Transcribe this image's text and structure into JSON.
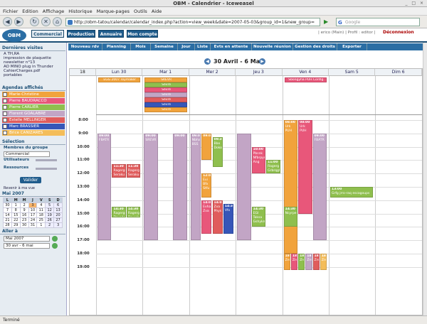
{
  "window": {
    "title": "OBM - Calendrier - Iceweasel",
    "controls": "_ □ ×"
  },
  "menu": [
    "Fichier",
    "Edition",
    "Affichage",
    "Historique",
    "Marque-pages",
    "Outils",
    "Aide"
  ],
  "nav": {
    "url": "http://obm-tatou/calendar/calendar_index.php?action=view_week&date=2007-05-03&group_id=1&new_group=",
    "search_placeholder": "Google",
    "search_engine_glyph": "G",
    "go_glyph": "▶",
    "back_glyph": "◀",
    "forward_glyph": "▶",
    "reload_glyph": "↻",
    "stop_glyph": "✕",
    "home_glyph": "⌂"
  },
  "app": {
    "logo": "OBM",
    "tabs": [
      "Commercial",
      "Production",
      "Annuaire",
      "Mon compte"
    ],
    "user_info": "| erico (Main) | Profil : editor |",
    "logout": "Déconnexion"
  },
  "sidebar": {
    "recent_title": "Dernières visites",
    "recent": [
      "A TH,RA",
      "impression de plaquette",
      "newsletter n°13",
      "AO MINO plug in Thunder",
      "CahierCharges.pdf",
      "portables"
    ],
    "agendas_title": "Agendas affichés",
    "agendas": [
      {
        "name": "Marie-Christine",
        "color": "#f1a33c"
      },
      {
        "name": "Pierre BAUDRACCO",
        "color": "#e8577a"
      },
      {
        "name": "Pierre CARLIER",
        "color": "#8fbf4e"
      },
      {
        "name": "Florent GOALABRE",
        "color": "#c2a5c5"
      },
      {
        "name": "Estelle MELLINGER",
        "color": "#e05c5c"
      },
      {
        "name": "Marc BRASSIER",
        "color": "#3656b8"
      },
      {
        "name": "Brice CANIZARES",
        "color": "#f4bd5a"
      }
    ],
    "selection_title": "Sélection",
    "group_label": "Membres du groupe",
    "group_value": "Commercial",
    "users_label": "Utilisateurs",
    "resources_label": "Ressources",
    "validate": "Valider",
    "back_to_view": "Revenir à ma vue",
    "month_title": "Mai 2007",
    "weekdays": [
      "L",
      "M",
      "M",
      "J",
      "V",
      "S",
      "D"
    ],
    "weeks": [
      [
        "30",
        "1",
        "2",
        "3",
        "4",
        "5",
        "6"
      ],
      [
        "7",
        "8",
        "9",
        "10",
        "11",
        "12",
        "13"
      ],
      [
        "14",
        "15",
        "16",
        "17",
        "18",
        "19",
        "20"
      ],
      [
        "21",
        "22",
        "23",
        "24",
        "25",
        "26",
        "27"
      ],
      [
        "28",
        "29",
        "30",
        "31",
        "1",
        "2",
        "3"
      ]
    ],
    "today": "3",
    "goto_title": "Aller à",
    "goto_month": "Mai 2007",
    "goto_week": "30 avr - 6 mai"
  },
  "toolbar": [
    "Nouveau rdv",
    "Planning",
    "Mois",
    "Semaine",
    "Jour",
    "Liste",
    "Evts en attente",
    "Nouvelle réunion",
    "Gestion des droits",
    "Exporter"
  ],
  "calendar": {
    "range": "30 Avril - 6 Mai",
    "week": "18",
    "days": [
      "Lun 30",
      "Mar 1",
      "Mer 2",
      "Jeu 3",
      "Ven 4",
      "Sam 5",
      "Dim 6"
    ],
    "hours": [
      "8:00",
      "9:00",
      "10:00",
      "11:00",
      "12:00",
      "13:00",
      "14:00",
      "15:00",
      "16:00",
      "17:00",
      "18:00",
      "19:00"
    ],
    "allday": [
      {
        "day": 0,
        "text": "EGG 2007 Toymaker Privé",
        "color": "#f1a33c"
      },
      {
        "day": 1,
        "text": "SREVR",
        "color": "#f1a33c"
      },
      {
        "day": 1,
        "text": "Sèvré",
        "color": "#8fbf4e"
      },
      {
        "day": 1,
        "text": "Sèvré",
        "color": "#e8577a"
      },
      {
        "day": 1,
        "text": "Sèvré",
        "color": "#c2a5c5"
      },
      {
        "day": 1,
        "text": "Sèvré",
        "color": "#e05c5c"
      },
      {
        "day": 1,
        "text": "Sèvré",
        "color": "#3656b8"
      },
      {
        "day": 1,
        "text": "Sèvré",
        "color": "#f1a33c"
      },
      {
        "day": 4,
        "text": "Sbongyha PUH Config",
        "color": "#e8577a"
      }
    ],
    "events": [
      {
        "day": 0,
        "col": 0,
        "cols": 3,
        "start": 9,
        "end": 17,
        "color": "#c2a5c5",
        "time": "09:00",
        "text": "FBATR"
      },
      {
        "day": 0,
        "col": 1,
        "cols": 3,
        "start": 11.3,
        "end": 12.3,
        "color": "#e05c5c",
        "time": "11:30",
        "text": "Ragergu Seraku"
      },
      {
        "day": 0,
        "col": 2,
        "cols": 3,
        "start": 11.3,
        "end": 12.3,
        "color": "#e05c5c",
        "time": "11:30",
        "text": "Ragergu Seraku"
      },
      {
        "day": 0,
        "col": 1,
        "cols": 3,
        "start": 14.5,
        "end": 15.3,
        "color": "#8fbf4e",
        "time": "14:30",
        "text": "Ragergu Druedon"
      },
      {
        "day": 0,
        "col": 2,
        "cols": 3,
        "start": 14.5,
        "end": 15.3,
        "color": "#8fbf4e",
        "time": "14:30",
        "text": "Ragergu Druedon"
      },
      {
        "day": 1,
        "col": 0,
        "cols": 3,
        "start": 9,
        "end": 17,
        "color": "#c2a5c5",
        "time": "09:00",
        "text": "SREVR"
      },
      {
        "day": 1,
        "col": 2,
        "cols": 3,
        "start": 9,
        "end": 17,
        "color": "#c2a5c5",
        "time": "09:00",
        "text": ""
      },
      {
        "day": 2,
        "col": 0,
        "cols": 4,
        "start": 9,
        "end": 17,
        "color": "#c2a5c5",
        "time": "09:00",
        "text": "Nbhary BSS"
      },
      {
        "day": 2,
        "col": 1,
        "cols": 4,
        "start": 9,
        "end": 11,
        "color": "#f1a33c",
        "time": "09:00",
        "text": ""
      },
      {
        "day": 2,
        "col": 2,
        "cols": 4,
        "start": 9.3,
        "end": 11.5,
        "color": "#8fbf4e",
        "time": "09:30",
        "text": "Bbo Doko"
      },
      {
        "day": 2,
        "col": 1,
        "cols": 4,
        "start": 12,
        "end": 13.8,
        "color": "#f1a33c",
        "time": "12:00",
        "text": "Evi Bfx Stfu"
      },
      {
        "day": 2,
        "col": 1,
        "cols": 4,
        "start": 14,
        "end": 16.5,
        "color": "#e8577a",
        "time": "14:00",
        "text": "Evhaon Zva"
      },
      {
        "day": 2,
        "col": 2,
        "cols": 4,
        "start": 14,
        "end": 16.5,
        "color": "#e05c5c",
        "time": "14:00",
        "text": "Zva Phys"
      },
      {
        "day": 2,
        "col": 3,
        "cols": 4,
        "start": 14.3,
        "end": 16.5,
        "color": "#3656b8",
        "time": "14:30",
        "text": "Vfx"
      },
      {
        "day": 3,
        "col": 0,
        "cols": 3,
        "start": 9,
        "end": 17,
        "color": "#c2a5c5",
        "time": "",
        "text": ""
      },
      {
        "day": 3,
        "col": 1,
        "cols": 3,
        "start": 10,
        "end": 12,
        "color": "#e8577a",
        "time": "10:00",
        "text": "Pbsnk Nfbrpyr Ang"
      },
      {
        "day": 3,
        "col": 2,
        "cols": 3,
        "start": 11,
        "end": 12,
        "color": "#8fbf4e",
        "time": "11:00",
        "text": "Ragerg Grbrqgh"
      },
      {
        "day": 3,
        "col": 1,
        "cols": 3,
        "start": 14.5,
        "end": 16,
        "color": "#8fbf4e",
        "time": "14:30",
        "text": "EGI Taksa Gshykm"
      },
      {
        "day": 4,
        "col": 0,
        "cols": 3,
        "start": 8,
        "end": 18,
        "color": "#f1a33c",
        "time": "08:00",
        "text": "Urk PUH"
      },
      {
        "day": 4,
        "col": 1,
        "cols": 3,
        "start": 8,
        "end": 15,
        "color": "#e8577a",
        "time": "08:00",
        "text": "Urk PUH"
      },
      {
        "day": 4,
        "col": 2,
        "cols": 3,
        "start": 9,
        "end": 17,
        "color": "#c2a5c5",
        "time": "09:00",
        "text": "FBATR"
      },
      {
        "day": 4,
        "col": 0,
        "cols": 3,
        "start": 14.5,
        "end": 16,
        "color": "#8fbf4e",
        "time": "14:30",
        "text": "Ncyrpe"
      },
      {
        "day": 5,
        "col": 0,
        "cols": 1,
        "start": 13,
        "end": 13.8,
        "color": "#8fbf4e",
        "time": "13:00",
        "text": "Grfg jrro-raq escagoups"
      }
    ],
    "evening": [
      {
        "day": 4,
        "col": 0,
        "cols": 6,
        "color": "#f1a33c",
        "time": "18:00",
        "text": "Zred"
      },
      {
        "day": 4,
        "col": 1,
        "cols": 6,
        "color": "#e8577a",
        "time": "18:00",
        "text": "Zred"
      },
      {
        "day": 4,
        "col": 2,
        "cols": 6,
        "color": "#8fbf4e",
        "time": "18:00",
        "text": "Zred"
      },
      {
        "day": 4,
        "col": 3,
        "cols": 6,
        "color": "#c2a5c5",
        "time": "18:00",
        "text": "Zred"
      },
      {
        "day": 4,
        "col": 4,
        "cols": 6,
        "color": "#e05c5c",
        "time": "18:00",
        "text": "Zred"
      },
      {
        "day": 4,
        "col": 5,
        "cols": 6,
        "color": "#f4bd5a",
        "time": "18:00",
        "text": "Zred"
      }
    ]
  },
  "status": "Terminé"
}
